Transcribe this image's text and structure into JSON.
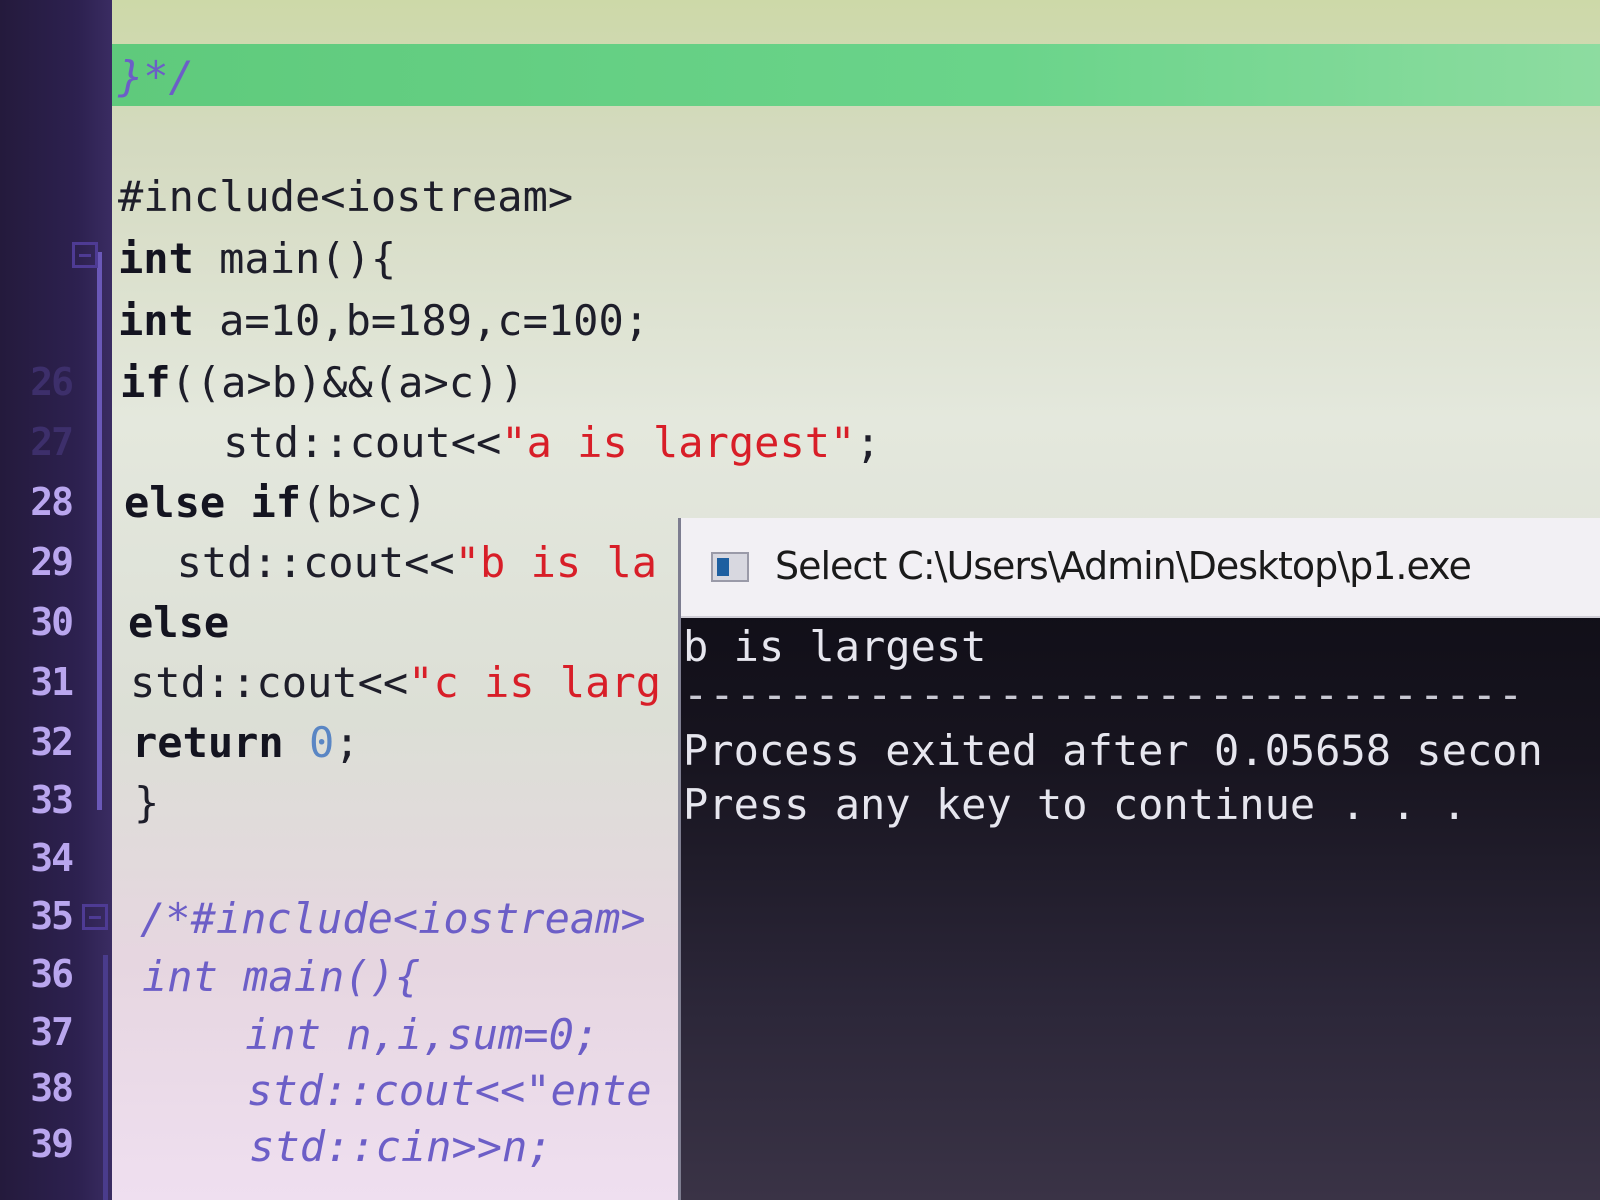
{
  "gutter": {
    "lines": [
      "26",
      "27",
      "28",
      "29",
      "30",
      "31",
      "32",
      "33",
      "34",
      "35",
      "36",
      "37",
      "38",
      "39"
    ]
  },
  "editor": {
    "comment_close": "}*/",
    "include": "#include<iostream>",
    "main_kw": "int",
    "main_rest": " main(){",
    "decl_kw": "int",
    "decl_rest": " a=10,b=189,c=100;",
    "if_kw": "if",
    "if_rest": "((a>b)&&(a>c))",
    "cout1_pre": "    std::cout<<",
    "cout1_str": "\"a is largest\"",
    "cout1_post": ";",
    "elseif_kw1": "else",
    "elseif_kw2": " if",
    "elseif_rest": "(b>c)",
    "cout2_pre": "  std::cout<<",
    "cout2_str": "\"b is la",
    "else_kw": "else",
    "cout3_pre": "std::cout<<",
    "cout3_str": "\"c is larg",
    "return_kw": "return",
    "return_val": "0",
    "return_post": ";",
    "close_brace": "}",
    "cmt1": "/*#include<iostream>",
    "cmt2": "int main(){",
    "cmt3": "    int n,i,sum=0;",
    "cmt4": "    std::cout<<\"ente",
    "cmt5": "    std::cin>>n;"
  },
  "console": {
    "title": "Select C:\\Users\\Admin\\Desktop\\p1.exe",
    "line1": "b is largest",
    "separator": "--------------------------------",
    "line2": "Process exited after 0.05658 secon",
    "line3": "Press any key to continue . . ."
  },
  "colors": {
    "string": "#d81e28",
    "number": "#5a86c4",
    "comment": "#6c5ec7",
    "highlight": "#5fca7c",
    "gutter": "#2d2150"
  }
}
